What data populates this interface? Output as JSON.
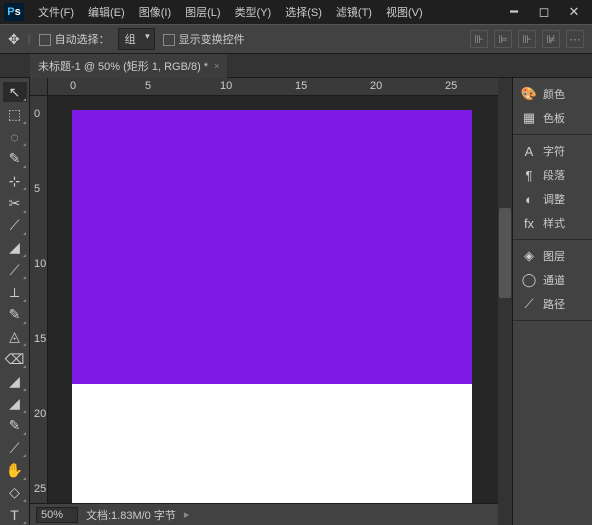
{
  "app": {
    "logo1": "P",
    "logo2": "s"
  },
  "menu": [
    "文件(F)",
    "编辑(E)",
    "图像(I)",
    "图层(L)",
    "类型(Y)",
    "选择(S)",
    "滤镜(T)",
    "视图(V)"
  ],
  "win": {
    "min": "━",
    "max": "◻",
    "close": "✕"
  },
  "opt": {
    "autoselect": "自动选择：",
    "group": "组",
    "transform": "显示变换控件"
  },
  "tab": {
    "title": "未标题-1 @ 50% (矩形 1, RGB/8) *"
  },
  "rulerH": [
    {
      "v": "0",
      "p": 22
    },
    {
      "v": "5",
      "p": 97
    },
    {
      "v": "10",
      "p": 172
    },
    {
      "v": "15",
      "p": 247
    },
    {
      "v": "20",
      "p": 322
    },
    {
      "v": "25",
      "p": 397
    }
  ],
  "rulerV": [
    {
      "v": "0",
      "p": 12
    },
    {
      "v": "5",
      "p": 87
    },
    {
      "v": "10",
      "p": 162
    },
    {
      "v": "15",
      "p": 237
    },
    {
      "v": "20",
      "p": 312
    },
    {
      "v": "25",
      "p": 387
    }
  ],
  "status": {
    "zoom": "50%",
    "doc": "文档:1.83M/0 字节"
  },
  "panels": [
    [
      {
        "i": "🎨",
        "t": "颜色"
      },
      {
        "i": "▦",
        "t": "色板"
      }
    ],
    [
      {
        "i": "A",
        "t": "字符"
      },
      {
        "i": "¶",
        "t": "段落"
      },
      {
        "i": "◐",
        "t": "调整"
      },
      {
        "i": "fx",
        "t": "样式"
      }
    ],
    [
      {
        "i": "◈",
        "t": "图层"
      },
      {
        "i": "◯",
        "t": "通道"
      },
      {
        "i": "⟋",
        "t": "路径"
      }
    ]
  ],
  "tools": [
    "↖",
    "⬚",
    "◌",
    "✎",
    "⊹",
    "✂",
    "⟋",
    "◢",
    "⟋",
    "⟂",
    "✎",
    "◬",
    "⌫",
    "◢",
    "◢",
    "✎",
    "⟋",
    "✋",
    "◇",
    "T"
  ]
}
